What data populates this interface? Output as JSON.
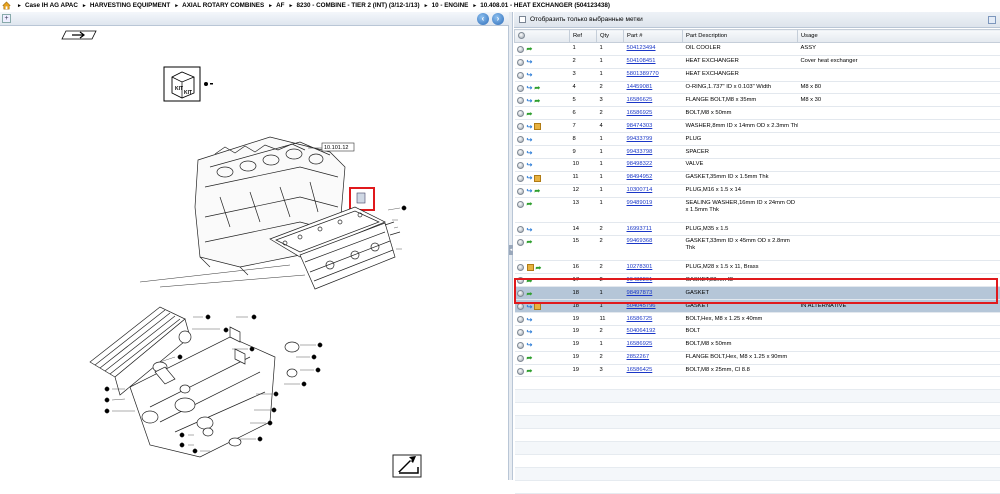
{
  "breadcrumb": {
    "items": [
      "Case IH AG APAC",
      "HARVESTING EQUIPMENT",
      "AXIAL ROTARY COMBINES",
      "AF",
      "8230 - COMBINE - TIER 2 (INT) (3/12-1/13)",
      "10 - ENGINE",
      "10.408.01 - HEAT EXCHANGER (504123438)"
    ],
    "separator": "►"
  },
  "diagram": {
    "ref_label": "10.101.12",
    "kit_label": "KIT",
    "nav_prev": "‹",
    "nav_next": "›"
  },
  "filter": {
    "label": "Отобразить только выбранные метки"
  },
  "table": {
    "headers": [
      "",
      "Ref",
      "Qty",
      "Part #",
      "Part Description",
      "Usage"
    ],
    "rows": [
      {
        "icons": [
          "dot",
          "green"
        ],
        "ref": "1",
        "qty": "1",
        "part": "504123494",
        "desc": "OIL COOLER",
        "usage": "ASSY"
      },
      {
        "icons": [
          "dot",
          "blue"
        ],
        "ref": "2",
        "qty": "1",
        "part": "504108451",
        "desc": "HEAT EXCHANGER",
        "usage": "Cover heat exchanger"
      },
      {
        "icons": [
          "dot",
          "blue"
        ],
        "ref": "3",
        "qty": "1",
        "part": "5801389770",
        "desc": "HEAT EXCHANGER",
        "usage": ""
      },
      {
        "icons": [
          "dot",
          "blue",
          "green"
        ],
        "ref": "4",
        "qty": "2",
        "part": "14459081",
        "desc": "O-RING,1.737\" ID x 0.103\" Width",
        "usage": "M8 x 80"
      },
      {
        "icons": [
          "dot",
          "blue",
          "green"
        ],
        "ref": "5",
        "qty": "3",
        "part": "16586625",
        "desc": "FLANGE BOLT,M8 x 35mm",
        "usage": "M8 x 30"
      },
      {
        "icons": [
          "dot",
          "green"
        ],
        "ref": "6",
        "qty": "2",
        "part": "16586925",
        "desc": "BOLT,M8 x 50mm",
        "usage": ""
      },
      {
        "icons": [
          "dot",
          "blue",
          "cube"
        ],
        "ref": "7",
        "qty": "4",
        "part": "98474303",
        "desc": "WASHER,8mm ID x 14mm OD x 2.3mm Thk",
        "usage": ""
      },
      {
        "icons": [
          "dot",
          "blue"
        ],
        "ref": "8",
        "qty": "1",
        "part": "99433799",
        "desc": "PLUG",
        "usage": ""
      },
      {
        "icons": [
          "dot",
          "blue"
        ],
        "ref": "9",
        "qty": "1",
        "part": "99433798",
        "desc": "SPACER",
        "usage": ""
      },
      {
        "icons": [
          "dot",
          "blue"
        ],
        "ref": "10",
        "qty": "1",
        "part": "98498322",
        "desc": "VALVE",
        "usage": ""
      },
      {
        "icons": [
          "dot",
          "blue",
          "cube"
        ],
        "ref": "11",
        "qty": "1",
        "part": "98494952",
        "desc": "GASKET,35mm ID x 1.5mm Thk",
        "usage": ""
      },
      {
        "icons": [
          "dot",
          "blue",
          "green"
        ],
        "ref": "12",
        "qty": "1",
        "part": "10300714",
        "desc": "PLUG,M16 x 1.5 x 14",
        "usage": ""
      },
      {
        "icons": [
          "dot",
          "green"
        ],
        "ref": "13",
        "qty": "1",
        "part": "99489019",
        "desc": "SEALING WASHER,16mm ID x 24mm OD x 1.5mm Thk",
        "usage": "",
        "tall": true
      },
      {
        "icons": [
          "dot",
          "blue"
        ],
        "ref": "14",
        "qty": "2",
        "part": "16993711",
        "desc": "PLUG,M35 x 1.5",
        "usage": ""
      },
      {
        "icons": [
          "dot",
          "green"
        ],
        "ref": "15",
        "qty": "2",
        "part": "99469368",
        "desc": "GASKET,33mm ID x 45mm OD x 2.8mm Thk",
        "usage": "",
        "tall": true
      },
      {
        "icons": [
          "dot",
          "cube",
          "green"
        ],
        "ref": "16",
        "qty": "2",
        "part": "10278301",
        "desc": "PLUG,M28 x 1.5 x 11, Brass",
        "usage": ""
      },
      {
        "icons": [
          "dot",
          "green"
        ],
        "ref": "17",
        "qty": "2",
        "part": "99432291",
        "desc": "GASKET,28mm ID",
        "usage": ""
      },
      {
        "icons": [
          "dot",
          "green"
        ],
        "ref": "18",
        "qty": "1",
        "part": "98497873",
        "desc": "GASKET",
        "usage": "",
        "selected": true
      },
      {
        "icons": [
          "dot",
          "blue",
          "cube"
        ],
        "ref": "18",
        "qty": "1",
        "part": "504045796",
        "desc": "GASKET",
        "usage": "IN ALTERNATIVE",
        "selected": true
      },
      {
        "icons": [
          "dot",
          "blue"
        ],
        "ref": "19",
        "qty": "11",
        "part": "16586725",
        "desc": "BOLT,Hex, M8 x 1.25 x 40mm",
        "usage": ""
      },
      {
        "icons": [
          "dot",
          "blue"
        ],
        "ref": "19",
        "qty": "2",
        "part": "504064192",
        "desc": "BOLT",
        "usage": ""
      },
      {
        "icons": [
          "dot",
          "blue"
        ],
        "ref": "19",
        "qty": "1",
        "part": "16586925",
        "desc": "BOLT,M8 x 50mm",
        "usage": ""
      },
      {
        "icons": [
          "dot",
          "green"
        ],
        "ref": "19",
        "qty": "2",
        "part": "2852267",
        "desc": "FLANGE BOLT,Hex, M8 x 1.25 x 90mm",
        "usage": ""
      },
      {
        "icons": [
          "dot",
          "green"
        ],
        "ref": "19",
        "qty": "3",
        "part": "16586425",
        "desc": "BOLT,M8 x 25mm, Cl 8.8",
        "usage": ""
      }
    ]
  },
  "colors": {
    "selection": "#b5c6d8",
    "highlight": "#e0191c",
    "link": "#1a37c7"
  }
}
